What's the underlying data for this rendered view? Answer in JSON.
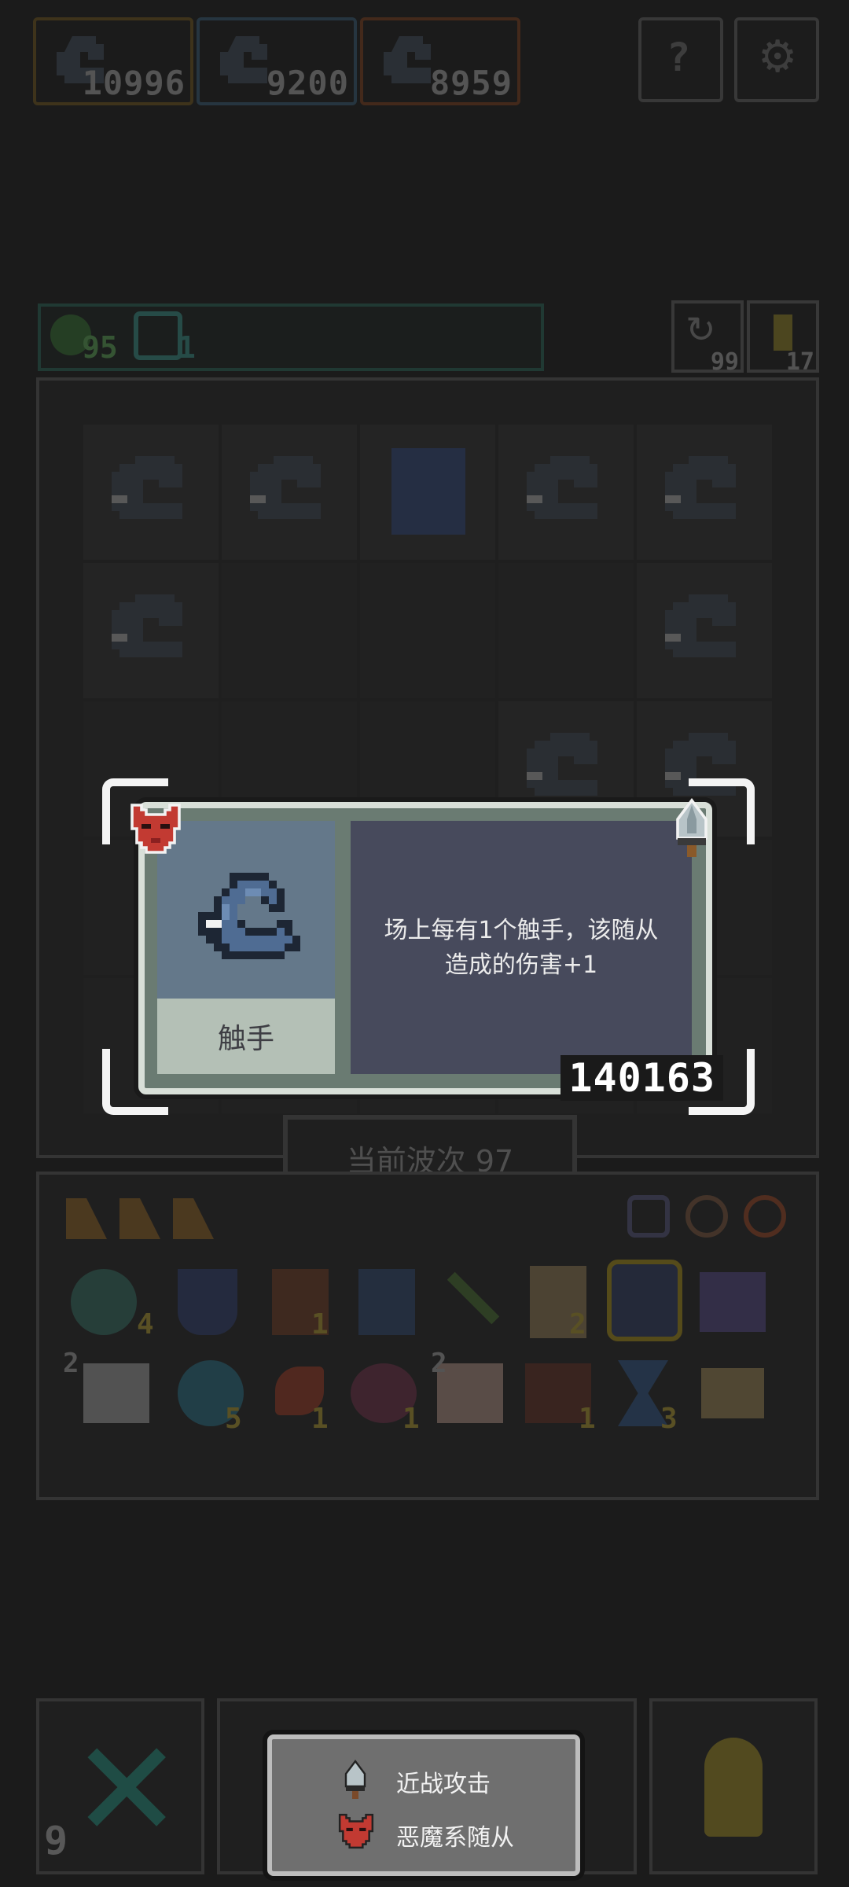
{
  "top_bar": {
    "players": [
      {
        "score": "10996",
        "border_color": "#8a6a1e"
      },
      {
        "score": "9200",
        "border_color": "#3f6f90"
      },
      {
        "score": "8959",
        "border_color": "#9a4a1e"
      }
    ],
    "buttons": [
      {
        "icon": "help-icon"
      },
      {
        "icon": "settings-icon"
      }
    ]
  },
  "status_bar": {
    "green_count": "95",
    "clock_count": "1",
    "refresh_count": "99",
    "piece_count": "17"
  },
  "wave": {
    "label": "当前波次 97"
  },
  "popup": {
    "unit_name": "触手",
    "description_line1": "场上每有1个触手，该随从",
    "description_line2": "造成的伤害+1",
    "score": "140163",
    "tags": [
      "demon-icon",
      "sword-icon"
    ]
  },
  "inventory": {
    "counts": [
      "4",
      "1",
      "2",
      "2",
      "5",
      "1",
      "1",
      "2",
      "1",
      "3"
    ]
  },
  "bottom_bar": {
    "close_count": "9"
  },
  "legend": {
    "items": [
      {
        "icon": "sword-icon",
        "label": "近战攻击"
      },
      {
        "icon": "demon-icon",
        "label": "恶魔系随从"
      }
    ]
  }
}
